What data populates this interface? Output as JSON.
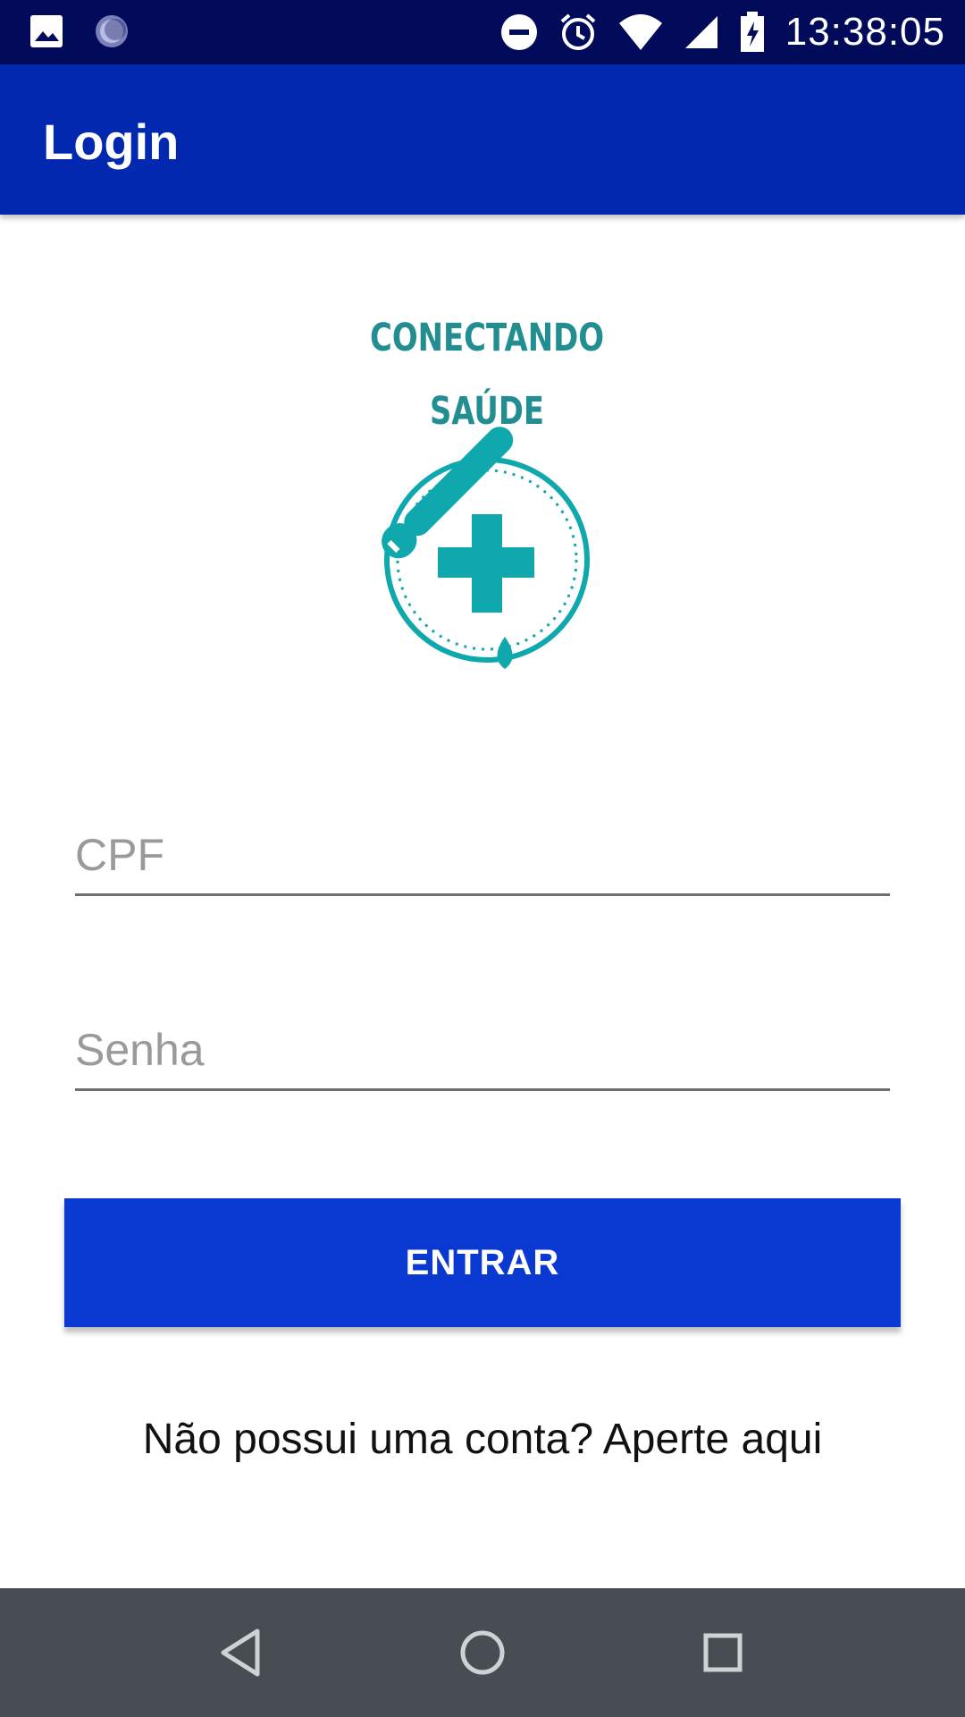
{
  "status_bar": {
    "time": "13:38:05",
    "icons": [
      "image-notification-icon",
      "sync-notification-icon",
      "do-not-disturb-icon",
      "alarm-icon",
      "wifi-icon",
      "cell-signal-icon",
      "battery-charging-icon"
    ],
    "background": "#020b5a"
  },
  "app_bar": {
    "title": "Login",
    "background": "#0328b0"
  },
  "logo": {
    "line1": "CONECTANDO",
    "line2": "SAÚDE",
    "color": "#0fa8ad"
  },
  "form": {
    "cpf_placeholder": "CPF",
    "cpf_value": "",
    "password_placeholder": "Senha",
    "password_value": "",
    "submit_label": "ENTRAR",
    "submit_color": "#0a39d2"
  },
  "signup_text": "Não possui uma conta? Aperte aqui",
  "nav_bar": {
    "buttons": [
      "back-icon",
      "home-icon",
      "recents-icon"
    ],
    "background": "#474d52"
  }
}
